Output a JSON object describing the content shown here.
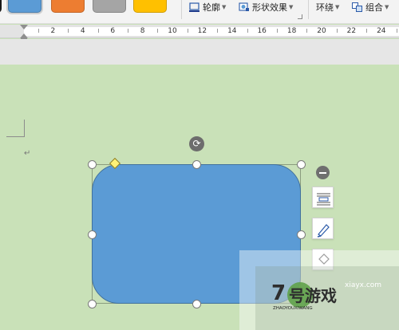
{
  "ribbon": {
    "style_swatches": [
      {
        "color": "#1b1b1b"
      },
      {
        "color": "#5b9bd5",
        "selected": true
      },
      {
        "color": "#ed7d31"
      },
      {
        "color": "#a5a5a5"
      },
      {
        "color": "#ffc000"
      }
    ],
    "outline_label": "轮廓",
    "shape_effects_label": "形状效果",
    "wrap_label": "环绕",
    "group_label": "组合"
  },
  "ruler": {
    "marks": [
      "2",
      "4",
      "6",
      "8",
      "10",
      "12",
      "14",
      "16",
      "18",
      "20",
      "22",
      "24"
    ]
  },
  "document": {
    "paragraph_mark": "↵",
    "shape": {
      "type": "rounded-rectangle",
      "fill": "#5b9bd5",
      "stroke": "#41719c"
    }
  },
  "watermark": {
    "brand_number": "7",
    "brand_cn": "号游戏",
    "pinyin": "ZHAOYOUXIWANG",
    "domain": "xiayx.com"
  }
}
